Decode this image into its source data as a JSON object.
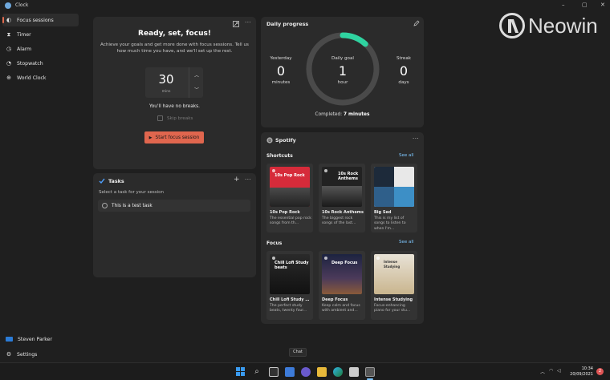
{
  "window": {
    "title": "Clock",
    "controls": [
      "–",
      "▢",
      "✕"
    ]
  },
  "sidebar": {
    "items": [
      {
        "label": "Focus sessions",
        "icon": "focus-icon",
        "active": true
      },
      {
        "label": "Timer",
        "icon": "hourglass-icon"
      },
      {
        "label": "Alarm",
        "icon": "alarm-icon"
      },
      {
        "label": "Stopwatch",
        "icon": "stopwatch-icon"
      },
      {
        "label": "World Clock",
        "icon": "globe-icon"
      }
    ],
    "user": "Steven Parker",
    "settings": "Settings"
  },
  "focus": {
    "title": "Ready, set, focus!",
    "description": "Achieve your goals and get more done with focus sessions. Tell us how much time you have, and we'll set up the rest.",
    "timer_value": "30",
    "timer_unit": "mins",
    "no_breaks": "You'll have no breaks.",
    "skip_breaks": "Skip breaks",
    "start_button": "Start focus session"
  },
  "tasks": {
    "title": "Tasks",
    "subtitle": "Select a task for your session",
    "items": [
      "This is a test task"
    ]
  },
  "progress": {
    "title": "Daily progress",
    "yesterday": {
      "label": "Yesterday",
      "value": "0",
      "unit": "minutes"
    },
    "goal": {
      "label": "Daily goal",
      "value": "1",
      "unit": "hour"
    },
    "streak": {
      "label": "Streak",
      "value": "0",
      "unit": "days"
    },
    "completed_prefix": "Completed: ",
    "completed_value": "7 minutes",
    "ring_fraction": 0.117,
    "ring_color": "#2fd3a0"
  },
  "spotify": {
    "title": "Spotify",
    "shortcuts": {
      "label": "Shortcuts",
      "see_all": "See all",
      "tiles": [
        {
          "title": "10s Pop Rock",
          "desc": "The essential pop rock songs from th...",
          "art_text": "10s Pop Rock"
        },
        {
          "title": "10s Rock Anthems",
          "desc": "The biggest rock songs of the last...",
          "art_text": "10s Rock Anthems"
        },
        {
          "title": "Big Sed",
          "desc": "This is my list of songs to listen to when I'm...",
          "art_text": ""
        }
      ]
    },
    "focus": {
      "label": "Focus",
      "see_all": "See all",
      "tiles": [
        {
          "title": "Chill Lofi Study B...",
          "desc": "The perfect study beats, twenty four...",
          "art_text": "Chill Lofi Study beats"
        },
        {
          "title": "Deep Focus",
          "desc": "Keep calm and focus with ambient and...",
          "art_text": "Deep Focus"
        },
        {
          "title": "Intense Studying",
          "desc": "Focus-enhancing piano for your stu...",
          "art_text": "Intense Studying"
        }
      ]
    }
  },
  "taskbar": {
    "tooltip": "Chat",
    "time": "10:34",
    "date": "20/09/2021",
    "notifications": "2"
  },
  "watermark": "Neowin"
}
